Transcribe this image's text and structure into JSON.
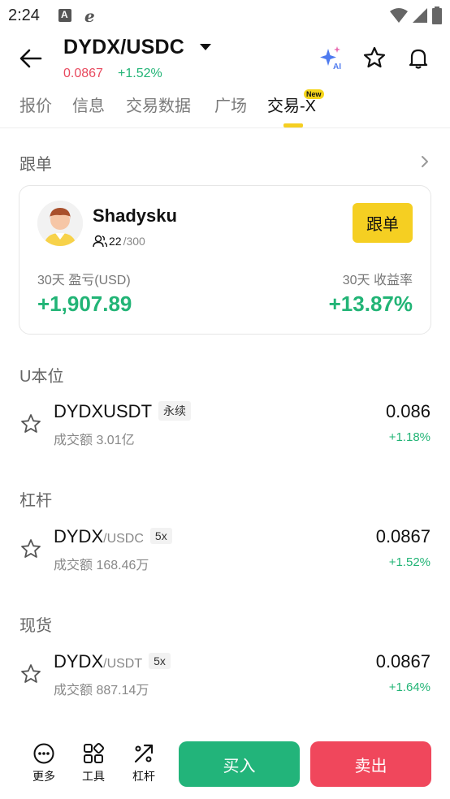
{
  "status_bar": {
    "time": "2:24"
  },
  "header": {
    "pair": "DYDX/USDC",
    "price": "0.0867",
    "change": "+1.52%"
  },
  "tabs": [
    {
      "label": "报价"
    },
    {
      "label": "信息"
    },
    {
      "label": "交易数据"
    },
    {
      "label": "广场"
    },
    {
      "label": "交易-X",
      "badge": "New",
      "active": true
    }
  ],
  "copy_trading": {
    "title": "跟单",
    "trader": {
      "name": "Shadysku",
      "followers": "22",
      "followers_max": "/300",
      "follow_label": "跟单",
      "pnl_label": "30天 盈亏(USD)",
      "pnl_value": "+1,907.89",
      "roi_label": "30天 收益率",
      "roi_value": "+13.87%"
    }
  },
  "sections": [
    {
      "title": "U本位",
      "symbol": "DYDXUSDT",
      "quote": "",
      "tag": "永续",
      "volume": "成交额 3.01亿",
      "price": "0.086",
      "change": "+1.18%"
    },
    {
      "title": "杠杆",
      "symbol": "DYDX",
      "quote": "/USDC",
      "tag": "5x",
      "volume": "成交额 168.46万",
      "price": "0.0867",
      "change": "+1.52%"
    },
    {
      "title": "现货",
      "symbol": "DYDX",
      "quote": "/USDT",
      "tag": "5x",
      "volume": "成交额 887.14万",
      "price": "0.0867",
      "change": "+1.64%"
    }
  ],
  "bottom_bar": {
    "more_label": "更多",
    "tools_label": "工具",
    "leverage_label": "杠杆",
    "buy_label": "买入",
    "sell_label": "卖出"
  },
  "colors": {
    "accent": "#f5cf22",
    "up": "#22b476",
    "down": "#e8495e",
    "buy": "#22b47a",
    "sell": "#f0475c"
  }
}
